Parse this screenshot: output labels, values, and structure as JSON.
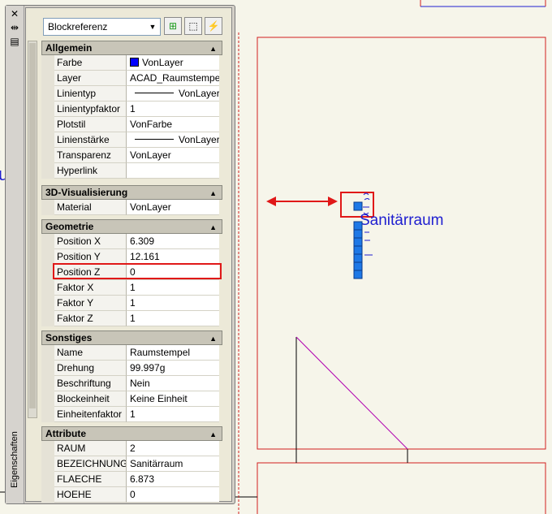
{
  "palette": {
    "vertical_title": "Eigenschaften",
    "select_value": "Blockreferenz",
    "titlebar_icons": [
      "close-icon",
      "autohide-icon",
      "properties-menu-icon"
    ],
    "toolbar_icons": [
      "toggle-pickadd-icon",
      "select-objects-icon",
      "quick-select-icon"
    ]
  },
  "sections": [
    {
      "title": "Allgemein",
      "rows": [
        {
          "label": "Farbe",
          "value": "VonLayer",
          "swatch": true
        },
        {
          "label": "Layer",
          "value": "ACAD_Raumstempel"
        },
        {
          "label": "Linientyp",
          "value": "VonLayer",
          "line": true
        },
        {
          "label": "Linientypfaktor",
          "value": "1"
        },
        {
          "label": "Plotstil",
          "value": "VonFarbe"
        },
        {
          "label": "Linienstärke",
          "value": "VonLayer",
          "line": true
        },
        {
          "label": "Transparenz",
          "value": "VonLayer"
        },
        {
          "label": "Hyperlink",
          "value": ""
        }
      ]
    },
    {
      "title": "3D-Visualisierung",
      "rows": [
        {
          "label": "Material",
          "value": "VonLayer"
        }
      ]
    },
    {
      "title": "Geometrie",
      "rows": [
        {
          "label": "Position X",
          "value": "6.309"
        },
        {
          "label": "Position Y",
          "value": "12.161"
        },
        {
          "label": "Position Z",
          "value": "0",
          "highlight": true
        },
        {
          "label": "Faktor X",
          "value": "1"
        },
        {
          "label": "Faktor Y",
          "value": "1"
        },
        {
          "label": "Faktor Z",
          "value": "1"
        }
      ]
    },
    {
      "title": "Sonstiges",
      "rows": [
        {
          "label": "Name",
          "value": "Raumstempel"
        },
        {
          "label": "Drehung",
          "value": "99.997g"
        },
        {
          "label": "Beschriftung",
          "value": "Nein"
        },
        {
          "label": "Blockeinheit",
          "value": "Keine Einheit"
        },
        {
          "label": "Einheitenfaktor",
          "value": "1"
        }
      ]
    },
    {
      "title": "Attribute",
      "rows": [
        {
          "label": "RAUM",
          "value": "2"
        },
        {
          "label": "BEZEICHNUNG",
          "value": "Sanitärraum"
        },
        {
          "label": "FLAECHE",
          "value": "6.873"
        },
        {
          "label": "HOEHE",
          "value": "0"
        }
      ]
    }
  ],
  "drawing": {
    "room_label": "Sanitärraum",
    "edge_glyph": "u",
    "colors": {
      "wall": "#d21e1e",
      "label": "#2020d0",
      "diagonal": "#b000b0",
      "highlight": "#e01818",
      "grip": "#1e78e6",
      "background": "#f6f5ea"
    }
  }
}
